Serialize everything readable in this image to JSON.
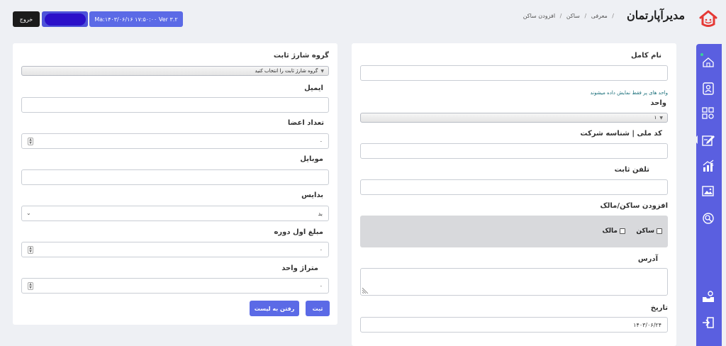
{
  "brand": {
    "name": "مدیرآپارتمان"
  },
  "breadcrumb": [
    "معرفی",
    "ساکن",
    "افزودن ساکن"
  ],
  "topbar": {
    "exit_label": "خروج",
    "version": "Ma:۱۴۰۳/۰۶/۱۶ ۱۷:۵۰:۰۰ Ver ۳.۲"
  },
  "resident_form": {
    "full_name_label": "نام کامل",
    "unit_hint": "واحد های پر فقط نمایش داده میشوند",
    "unit_label": "واحد",
    "unit_value": "۱",
    "national_id_label": "کد ملی | شناسه شرکت",
    "phone_label": "تلفن ثابت",
    "add_owner_label": "افزودن ساکن/مالک",
    "resident_check_label": "ساکن",
    "owner_check_label": "مالک",
    "address_label": "آدرس",
    "date_label": "تاریخ",
    "date_value": "۱۴۰۳/۰۶/۲۴"
  },
  "charge_form": {
    "charge_group_label": "گروه شارژ ثابت",
    "charge_group_placeholder": "گروه شارژ ثابت را انتخاب کنید",
    "email_label": "ایمیل",
    "members_label": "تعداد اعضا",
    "members_value": "۰",
    "mobile_label": "موبایل",
    "debit_label": "بدایس",
    "debit_value": "بد",
    "initial_amount_label": "مبلغ اول دوره",
    "initial_amount_value": "۰",
    "area_label": "متراژ واحد",
    "area_value": "۰",
    "submit_label": "ثبت",
    "list_label": "رفتن به لیست"
  },
  "sidebar": {
    "items": [
      "home-icon",
      "profile-card-icon",
      "grid-settings-icon",
      "edit-icon",
      "finance-chart-icon",
      "photo-icon",
      "search-settings-icon",
      "inbox-settings-icon",
      "logout-icon"
    ]
  },
  "colors": {
    "accent": "#5b6ae6",
    "sidebar": "#5a5fe0",
    "logo_red": "#e53935"
  }
}
